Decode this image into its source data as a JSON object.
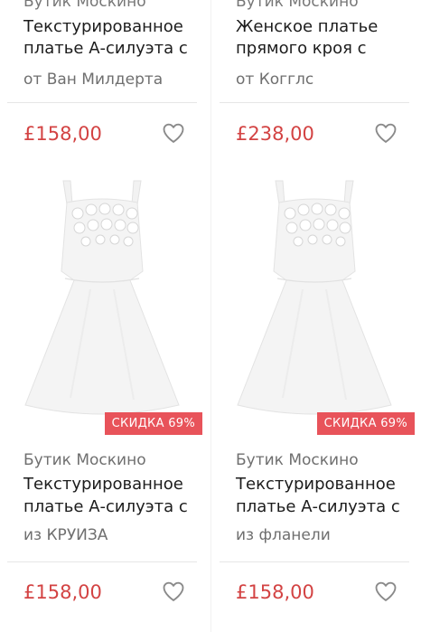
{
  "columns": [
    {
      "top_card": {
        "brand": "Бутик Москино",
        "title_line1": "Текстурированное",
        "title_line2": "платье А-силуэта с",
        "subtitle": "от Ван Милдерта",
        "price": "£158,00"
      },
      "bottom_card": {
        "badge": "СКИДКА 69%",
        "brand": "Бутик Москино",
        "title_line1": "Текстурированное",
        "title_line2": "платье А-силуэта с",
        "subtitle": "из КРУИЗА",
        "price": "£158,00"
      }
    },
    {
      "top_card": {
        "brand": "Бутик Москино",
        "title_line1": "Женское платье",
        "title_line2": "прямого кроя с",
        "subtitle": "от Когглс",
        "price": "£238,00"
      },
      "bottom_card": {
        "badge": "СКИДКА 69%",
        "brand": "Бутик Москино",
        "title_line1": "Текстурированное",
        "title_line2": "платье А-силуэта с",
        "subtitle": "из фланели",
        "price": "£158,00"
      }
    }
  ],
  "icons": {
    "favorite": "heart-outline-icon"
  },
  "colors": {
    "price": "#d34343",
    "badge_bg": "#e8535a",
    "badge_text": "#ffffff",
    "heart_outline": "#8a8a8a"
  }
}
